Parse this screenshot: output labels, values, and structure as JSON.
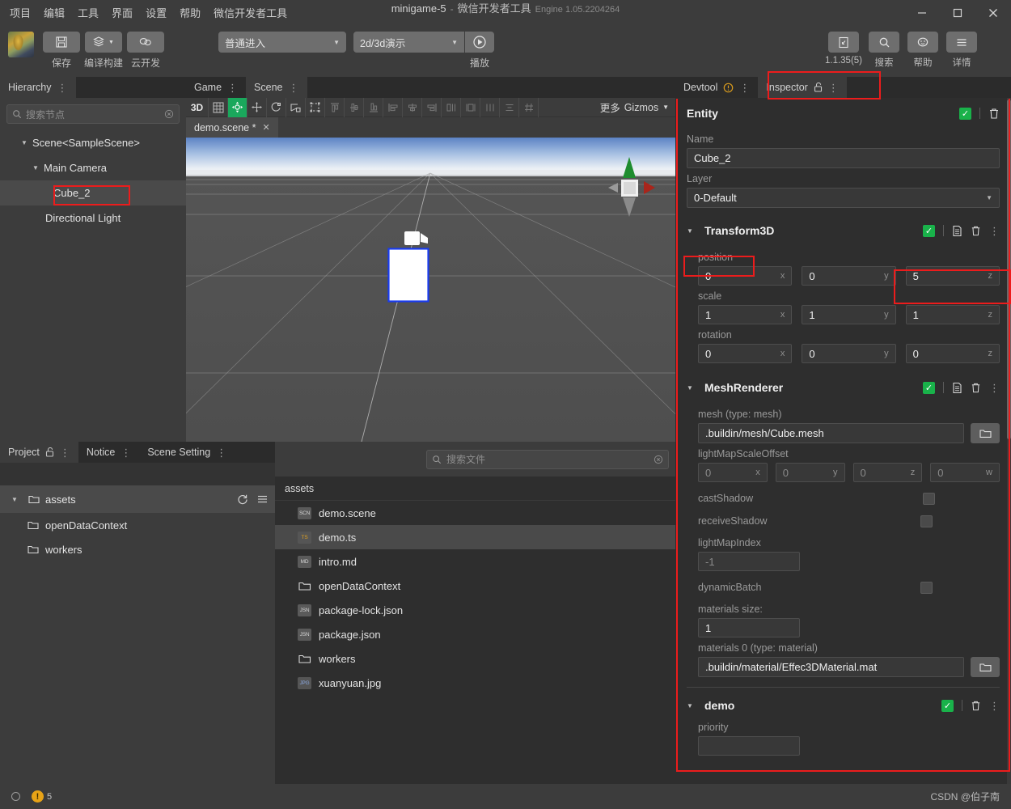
{
  "window": {
    "title_main": "minigame-5",
    "title_sep": "-",
    "title_sub": "微信开发者工具",
    "title_engine": "Engine 1.05.2204264",
    "minimize": "–",
    "maximize": "▢",
    "close": "✕"
  },
  "menubar": {
    "items": [
      {
        "label": "项目"
      },
      {
        "label": "编辑"
      },
      {
        "label": "工具"
      },
      {
        "label": "界面"
      },
      {
        "label": "设置"
      },
      {
        "label": "帮助"
      },
      {
        "label": "微信开发者工具"
      }
    ]
  },
  "toolbar": {
    "save_label": "保存",
    "build_label": "编译构建",
    "cloud_label": "云开发",
    "mode_select": "普通进入",
    "preview_select": "2d/3d演示",
    "play_label": "播放",
    "version_label": "1.1.35(5)",
    "search_label": "搜索",
    "help_label": "帮助",
    "detail_label": "详情",
    "icons": {
      "save": "save-icon",
      "build": "layers-icon",
      "cloud": "cloud-icon",
      "play": "play-icon",
      "version": "device-icon",
      "search": "search-icon",
      "help": "smiley-icon",
      "detail": "hamburger-icon"
    }
  },
  "hierarchy": {
    "tab_label": "Hierarchy",
    "search_placeholder": "搜索节点",
    "nodes": [
      {
        "label": "Scene<SampleScene>",
        "indent": 0,
        "expandable": true,
        "selected": false,
        "highlighted": false
      },
      {
        "label": "Main Camera",
        "indent": 1,
        "expandable": true,
        "selected": false,
        "highlighted": false
      },
      {
        "label": "Cube_2",
        "indent": 2,
        "expandable": false,
        "selected": true,
        "highlighted": true
      },
      {
        "label": "Directional Light",
        "indent": 1,
        "expandable": false,
        "selected": false,
        "highlighted": false
      }
    ]
  },
  "scene_panel": {
    "tabs": [
      {
        "label": "Game",
        "active": false
      },
      {
        "label": "Scene",
        "active": true
      }
    ],
    "toolbar_3d_label": "3D",
    "gizmos_more_label": "更多",
    "gizmos_label": "Gizmos",
    "tools": [
      {
        "name": "grid-icon",
        "active": false,
        "dim": false
      },
      {
        "name": "move-gizmo-icon",
        "active": true,
        "dim": false
      },
      {
        "name": "translate-icon",
        "active": false,
        "dim": false
      },
      {
        "name": "rotate-icon",
        "active": false,
        "dim": false
      },
      {
        "name": "scale-icon",
        "active": false,
        "dim": false
      },
      {
        "name": "rect-transform-icon",
        "active": false,
        "dim": false
      },
      {
        "name": "align-top-icon",
        "active": false,
        "dim": true
      },
      {
        "name": "align-vertical-center-icon",
        "active": false,
        "dim": true
      },
      {
        "name": "align-bottom-icon",
        "active": false,
        "dim": true
      },
      {
        "name": "align-left-icon",
        "active": false,
        "dim": true
      },
      {
        "name": "align-horizontal-center-icon",
        "active": false,
        "dim": true
      },
      {
        "name": "align-right-icon",
        "active": false,
        "dim": true
      },
      {
        "name": "distribute-left-icon",
        "active": false,
        "dim": true
      },
      {
        "name": "distribute-center-icon",
        "active": false,
        "dim": true
      },
      {
        "name": "distribute-horizontal-icon",
        "active": false,
        "dim": true
      },
      {
        "name": "distribute-vertical-icon",
        "active": false,
        "dim": true
      },
      {
        "name": "spacing-icon",
        "active": false,
        "dim": true
      }
    ],
    "file_tab": "demo.scene *",
    "file_tab_close": "✕"
  },
  "project": {
    "tabs": [
      {
        "label": "Project",
        "active": true,
        "lock": true
      },
      {
        "label": "Notice",
        "active": false,
        "lock": false
      },
      {
        "label": "Scene Setting",
        "active": false,
        "lock": false
      }
    ],
    "root": {
      "label": "assets",
      "expanded": true
    },
    "children": [
      {
        "label": "openDataContext"
      },
      {
        "label": "workers"
      }
    ]
  },
  "filelist": {
    "search_placeholder": "搜索文件",
    "breadcrumb": "assets",
    "files": [
      {
        "name": "demo.scene",
        "tag": "SCN",
        "kind": "file",
        "selected": false
      },
      {
        "name": "demo.ts",
        "tag": "TS",
        "kind": "ts",
        "selected": true
      },
      {
        "name": "intro.md",
        "tag": "MD",
        "kind": "file",
        "selected": false
      },
      {
        "name": "openDataContext",
        "tag": "",
        "kind": "folder",
        "selected": false
      },
      {
        "name": "package-lock.json",
        "tag": "JSN",
        "kind": "file",
        "selected": false
      },
      {
        "name": "package.json",
        "tag": "JSN",
        "kind": "file",
        "selected": false
      },
      {
        "name": "workers",
        "tag": "",
        "kind": "folder",
        "selected": false
      },
      {
        "name": "xuanyuan.jpg",
        "tag": "JPG",
        "kind": "jpg",
        "selected": false
      }
    ]
  },
  "inspector": {
    "tabs": [
      {
        "label": "Devtool",
        "active": false,
        "badge": "!",
        "lock": false
      },
      {
        "label": "Inspector",
        "active": true,
        "badge": "",
        "lock": true
      }
    ],
    "entity": {
      "title": "Entity",
      "name_label": "Name",
      "name_value": "Cube_2",
      "layer_label": "Layer",
      "layer_value": "0-Default"
    },
    "transform": {
      "title": "Transform3D",
      "position_label": "position",
      "position": [
        {
          "value": "0",
          "axis": "x"
        },
        {
          "value": "0",
          "axis": "y"
        },
        {
          "value": "5",
          "axis": "z"
        }
      ],
      "scale_label": "scale",
      "scale": [
        {
          "value": "1",
          "axis": "x"
        },
        {
          "value": "1",
          "axis": "y"
        },
        {
          "value": "1",
          "axis": "z"
        }
      ],
      "rotation_label": "rotation",
      "rotation": [
        {
          "value": "0",
          "axis": "x"
        },
        {
          "value": "0",
          "axis": "y"
        },
        {
          "value": "0",
          "axis": "z"
        }
      ]
    },
    "meshrenderer": {
      "title": "MeshRenderer",
      "mesh_label": "mesh (type: mesh)",
      "mesh_value": ".buildin/mesh/Cube.mesh",
      "lightmap_label": "lightMapScaleOffset",
      "lightmap": [
        {
          "value": "0",
          "axis": "x"
        },
        {
          "value": "0",
          "axis": "y"
        },
        {
          "value": "0",
          "axis": "z"
        },
        {
          "value": "0",
          "axis": "w"
        }
      ],
      "cast_shadow_label": "castShadow",
      "cast_shadow_checked": false,
      "receive_shadow_label": "receiveShadow",
      "receive_shadow_checked": false,
      "lightmap_index_label": "lightMapIndex",
      "lightmap_index_value": "-1",
      "dynamic_batch_label": "dynamicBatch",
      "dynamic_batch_checked": false,
      "materials_size_label": "materials size:",
      "materials_size_value": "1",
      "materials0_label": "materials 0 (type: material)",
      "materials0_value": ".buildin/material/Effec3DMaterial.mat"
    },
    "demo": {
      "title": "demo",
      "priority_label": "priority"
    }
  },
  "statusbar": {
    "warning_count": "5",
    "watermark": "CSDN @伯子南"
  },
  "colors": {
    "accent_green": "#19b24a",
    "annotation_red": "#ec1c1c",
    "panel_bg": "#3c3c3c",
    "inspector_bg": "#2e2e2e",
    "warn_orange": "#e8a317"
  }
}
